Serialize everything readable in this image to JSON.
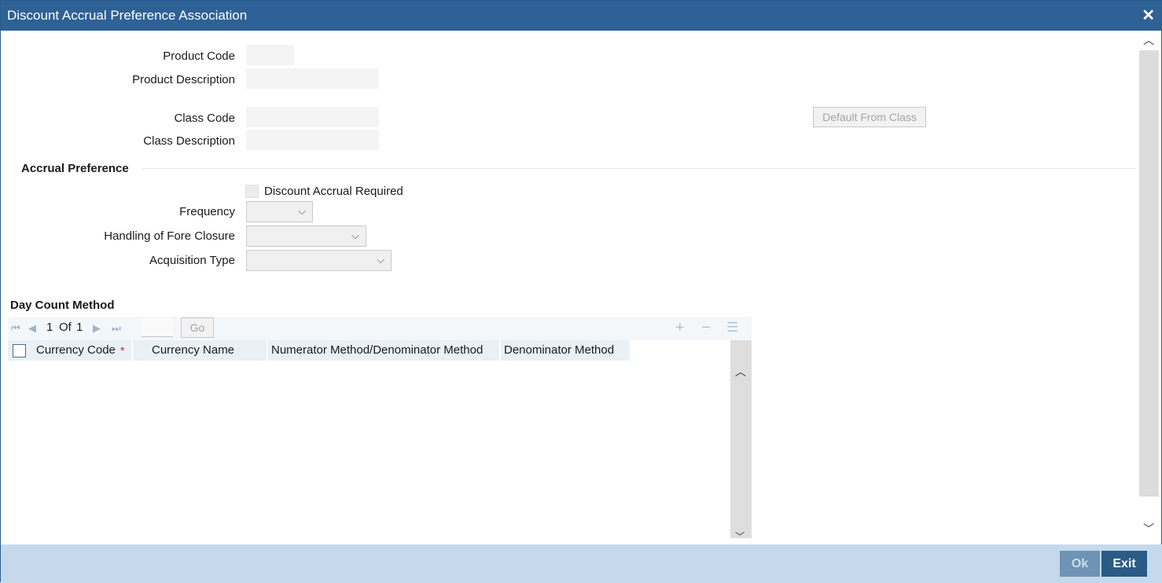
{
  "window": {
    "title": "Discount Accrual Preference Association",
    "close_icon": "close-icon"
  },
  "form": {
    "product_code_label": "Product Code",
    "product_code_value": "",
    "product_description_label": "Product Description",
    "product_description_value": "",
    "class_code_label": "Class Code",
    "class_code_value": "",
    "class_description_label": "Class Description",
    "class_description_value": "",
    "default_from_class_label": "Default From Class"
  },
  "accrual": {
    "section_title": "Accrual Preference",
    "discount_accrual_required_label": "Discount Accrual Required",
    "discount_accrual_required_checked": false,
    "frequency_label": "Frequency",
    "frequency_value": "",
    "fore_closure_label": "Handling of Fore Closure",
    "fore_closure_value": "",
    "acquisition_type_label": "Acquisition Type",
    "acquisition_type_value": ""
  },
  "day_count": {
    "section_title": "Day Count Method",
    "pager": {
      "current": "1",
      "of_label": "Of",
      "total": "1",
      "go_label": "Go"
    },
    "columns": [
      {
        "label": "Currency Code",
        "required": true
      },
      {
        "label": "Currency Name",
        "required": false
      },
      {
        "label": "Numerator Method/Denominator Method",
        "required": false
      },
      {
        "label": "Denominator Method",
        "required": false
      }
    ],
    "rows": []
  },
  "footer": {
    "ok_label": "Ok",
    "exit_label": "Exit"
  },
  "colors": {
    "titlebar": "#2e6195",
    "footer": "#c4d9ec",
    "exit_button": "#2a5a86",
    "ok_button": "#6e93b5",
    "required_star": "#d02020"
  }
}
